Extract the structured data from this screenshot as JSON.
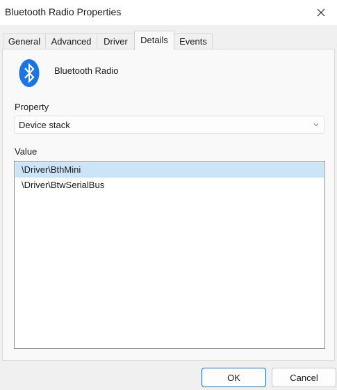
{
  "window": {
    "title": "Bluetooth Radio Properties"
  },
  "tabs": [
    {
      "label": "General",
      "active": false
    },
    {
      "label": "Advanced",
      "active": false
    },
    {
      "label": "Driver",
      "active": false
    },
    {
      "label": "Details",
      "active": true
    },
    {
      "label": "Events",
      "active": false
    }
  ],
  "details": {
    "device_name": "Bluetooth Radio",
    "device_icon": "bluetooth-icon",
    "property_label": "Property",
    "property_selected": "Device stack",
    "value_label": "Value",
    "values": [
      {
        "text": "\\Driver\\BthMini",
        "selected": true
      },
      {
        "text": "\\Driver\\BtwSerialBus",
        "selected": false
      }
    ]
  },
  "buttons": {
    "ok": "OK",
    "cancel": "Cancel"
  },
  "colors": {
    "bluetooth_blue": "#1b73e8",
    "selection": "#cce4f7",
    "ok_border": "#1a6fc0"
  }
}
